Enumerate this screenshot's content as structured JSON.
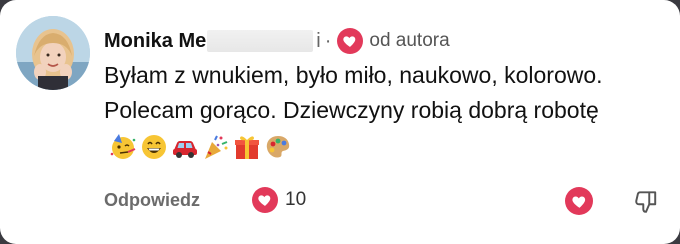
{
  "comment": {
    "author_visible": "Monika Me",
    "name_tail": "i",
    "separator": "·",
    "author_badge": "od autora",
    "text": "Byłam z wnukiem, było miło, naukowo, kolorowo. Polecam gorąco. Dziewczyny robią dobrą robotę",
    "emojis": [
      "partying-face",
      "grinning-face",
      "red-car",
      "party-popper",
      "wrapped-gift",
      "artist-palette"
    ]
  },
  "footer": {
    "reply_label": "Odpowiedz",
    "likes_count": "10"
  },
  "colors": {
    "accent": "#e2395a",
    "name": "#111111",
    "muted": "#666666"
  },
  "icons": {
    "avatar": "profile-photo",
    "author_heart": "heart-icon",
    "like": "heart-icon",
    "dislike": "thumbs-down-icon"
  }
}
